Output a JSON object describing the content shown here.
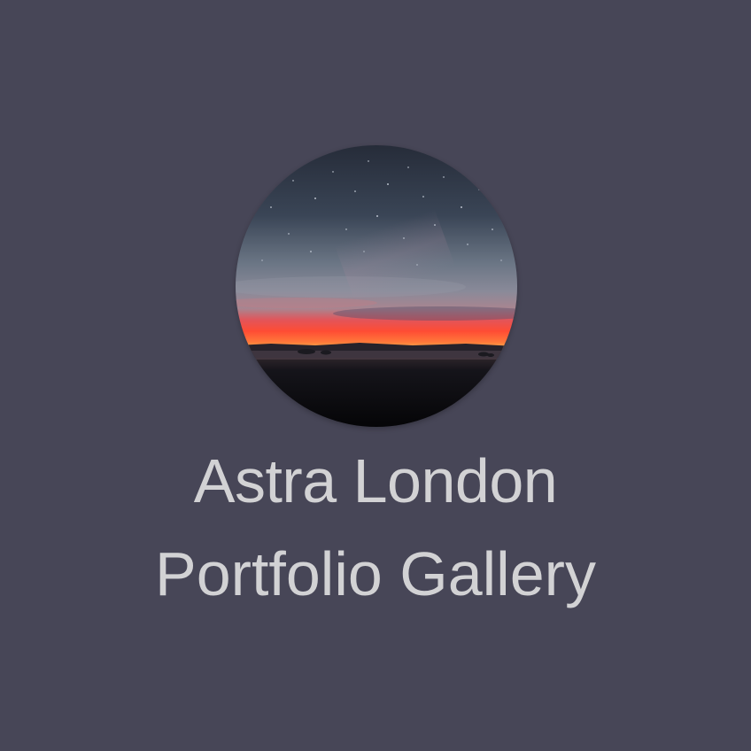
{
  "profile": {
    "name": "Astra London",
    "tagline": "Portfolio Gallery",
    "avatar_icon": "night-sky-sunset-photo"
  },
  "colors": {
    "background": "#474657",
    "text": "#d2d2d4",
    "sky_top": "#2a3140",
    "horizon_glow": "#ff5a3c"
  }
}
